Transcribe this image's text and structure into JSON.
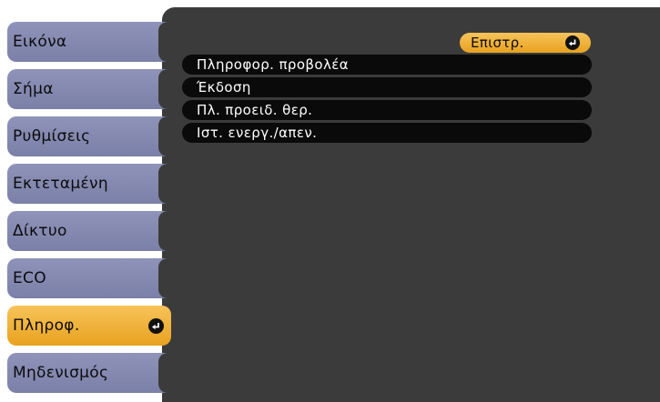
{
  "sidebar": {
    "items": [
      {
        "label": "Εικόνα"
      },
      {
        "label": "Σήμα"
      },
      {
        "label": "Ρυθμίσεις"
      },
      {
        "label": "Εκτεταμένη"
      },
      {
        "label": "Δίκτυο"
      },
      {
        "label": "ECO"
      },
      {
        "label": "Πληροφ.",
        "selected": true
      },
      {
        "label": "Μηδενισμός"
      }
    ]
  },
  "main": {
    "back_button": "Επιστρ.",
    "items": [
      {
        "label": "Πληροφορ. προβολέα"
      },
      {
        "label": "Έκδοση"
      },
      {
        "label": "Πλ. προειδ. θερ."
      },
      {
        "label": "Ιστ. ενεργ./απεν."
      }
    ]
  },
  "icons": {
    "enter": "enter-return-icon"
  },
  "colors": {
    "tab": "#8589b1",
    "tab_selected": "#f0b43a",
    "panel": "#3b3b3b",
    "row": "#0a0a0a"
  }
}
